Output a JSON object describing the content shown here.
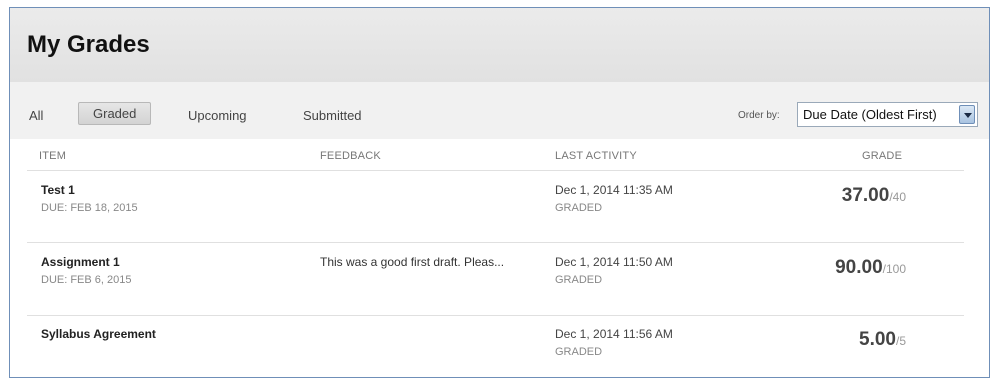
{
  "header": {
    "title": "My Grades"
  },
  "filters": {
    "tabs": [
      {
        "label": "All"
      },
      {
        "label": "Graded",
        "active": true
      },
      {
        "label": "Upcoming"
      },
      {
        "label": "Submitted"
      }
    ],
    "order_label": "Order by:",
    "order_value": "Due Date (Oldest First)"
  },
  "columns": {
    "item": "ITEM",
    "feedback": "FEEDBACK",
    "last_activity": "LAST ACTIVITY",
    "grade": "GRADE"
  },
  "rows": [
    {
      "name": "Test 1",
      "due": "DUE: FEB 18, 2015",
      "feedback": "",
      "activity_date": "Dec 1, 2014 11:35 AM",
      "activity_status": "GRADED",
      "score": "37.00",
      "max": "/40"
    },
    {
      "name": "Assignment 1",
      "due": "DUE: FEB 6, 2015",
      "feedback": "This was a good first draft. Pleas...",
      "activity_date": "Dec 1, 2014 11:50 AM",
      "activity_status": "GRADED",
      "score": "90.00",
      "max": "/100"
    },
    {
      "name": "Syllabus Agreement",
      "due": "",
      "feedback": "",
      "activity_date": "Dec 1, 2014 11:56 AM",
      "activity_status": "GRADED",
      "score": "5.00",
      "max": "/5"
    }
  ]
}
